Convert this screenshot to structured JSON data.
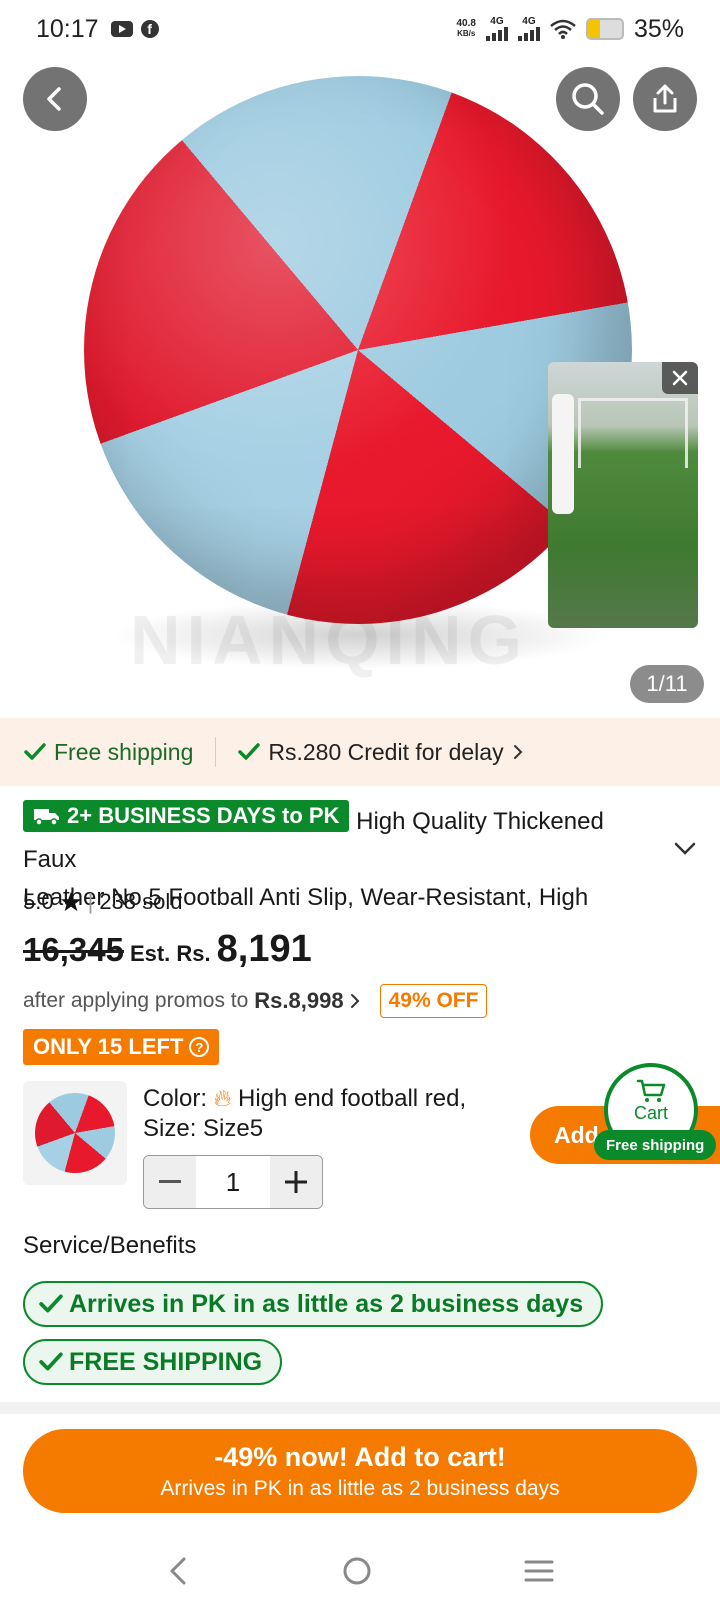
{
  "status_bar": {
    "time": "10:17",
    "net_speed_value": "40.8",
    "net_speed_unit": "KB/s",
    "signal1": "4G",
    "signal2": "4G",
    "battery": "35%"
  },
  "gallery": {
    "counter": "1/11",
    "watermark": "NIANQING"
  },
  "shipping_strip": {
    "free_shipping": "Free shipping",
    "credit": "Rs.280 Credit for delay"
  },
  "product": {
    "delivery_badge": "2+ BUSINESS DAYS to PK",
    "title_line1": "High Quality Thickened Faux",
    "title_line2": "Leather No.5 Football Anti Slip, Wear-Resistant, High",
    "rating": "5.0",
    "sold": "238 sold",
    "old_price": "16,345",
    "est_label": "Est. Rs.",
    "price": "8,191",
    "promo_prefix": "after applying promos to",
    "promo_price": "Rs.8,998",
    "discount_badge": "49% OFF",
    "stock_badge": "ONLY 15 LEFT"
  },
  "sku": {
    "color_label": "Color:",
    "color_value": "High end football red,",
    "size_label": "Size:",
    "size_value": "Size5",
    "quantity": "1",
    "add_label": "Add"
  },
  "cart_float": {
    "label": "Cart",
    "badge": "Free shipping"
  },
  "services": {
    "title": "Service/Benefits",
    "items": [
      "Arrives in PK in as little as 2 business days",
      "FREE SHIPPING"
    ]
  },
  "cta": {
    "line1": "-49% now! Add to cart!",
    "line2": "Arrives in PK in as little as 2 business days"
  },
  "colors": {
    "accent_orange": "#f57a00",
    "accent_green": "#0a8a2a"
  }
}
